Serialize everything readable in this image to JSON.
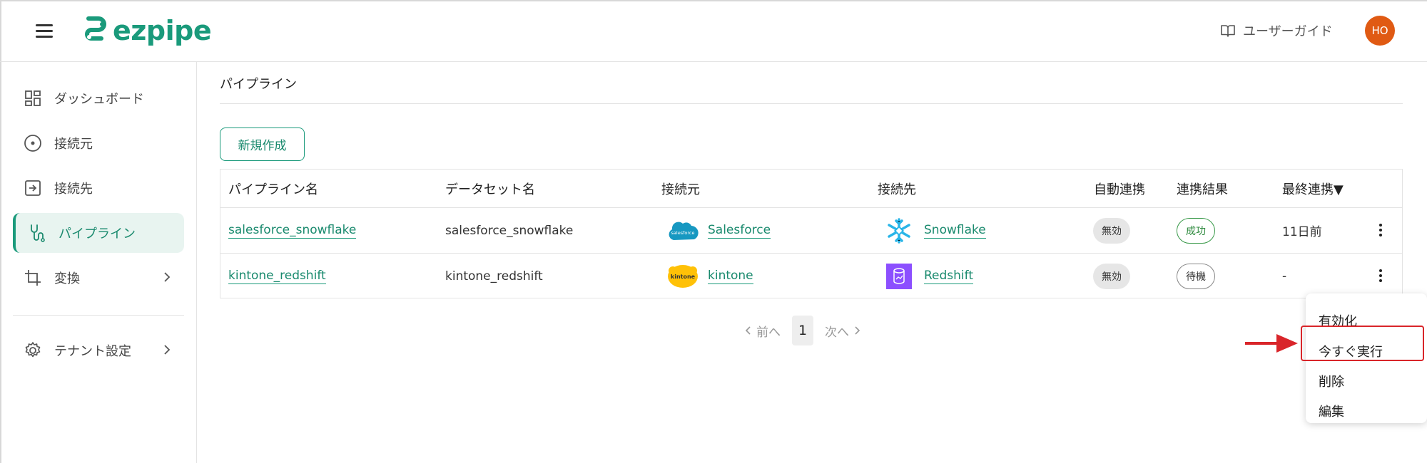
{
  "header": {
    "logo_text": "ezpipe",
    "guide_label": "ユーザーガイド",
    "avatar_initials": "HO",
    "brand_color": "#1a9a7b",
    "avatar_color": "#e05a13"
  },
  "sidebar": {
    "items": [
      {
        "label": "ダッシュボード",
        "icon": "dashboard-icon"
      },
      {
        "label": "接続元",
        "icon": "source-icon"
      },
      {
        "label": "接続先",
        "icon": "destination-icon"
      },
      {
        "label": "パイプライン",
        "icon": "pipeline-icon",
        "active": true
      },
      {
        "label": "変換",
        "icon": "crop-icon",
        "has_chevron": true
      },
      {
        "label": "テナント設定",
        "icon": "gear-icon",
        "has_chevron": true
      }
    ]
  },
  "main": {
    "page_title": "パイプライン",
    "new_button": "新規作成",
    "table": {
      "headers": [
        "パイプライン名",
        "データセット名",
        "接続元",
        "接続先",
        "自動連携",
        "連携結果",
        "最終連携▼"
      ],
      "rows": [
        {
          "name": "salesforce_snowflake",
          "dataset": "salesforce_snowflake",
          "source": "Salesforce",
          "source_logo": "salesforce",
          "destination": "Snowflake",
          "auto": "無効",
          "result": "成功",
          "last": "11日前"
        },
        {
          "name": "kintone_redshift",
          "dataset": "kintone_redshift",
          "source": "kintone",
          "source_logo": "kintone",
          "destination": "Redshift",
          "auto": "無効",
          "result": "待機",
          "last": "-"
        }
      ]
    },
    "pagination": {
      "prev": "前へ",
      "current": "1",
      "next": "次へ"
    }
  },
  "context_menu": {
    "items": [
      "有効化",
      "今すぐ実行",
      "削除",
      "編集"
    ],
    "highlighted_item": "今すぐ実行",
    "highlight_color": "#d9252a"
  }
}
